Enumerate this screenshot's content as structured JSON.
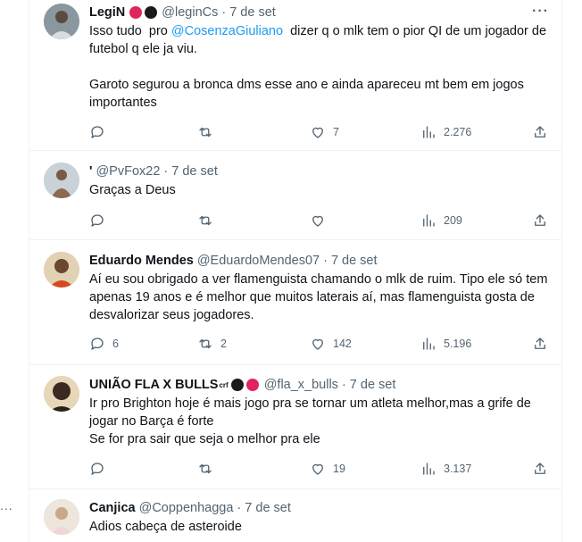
{
  "side": {
    "more_glyph": "..."
  },
  "tweets": [
    {
      "name": "LegiN",
      "handle": "@leginCs",
      "dot": "·",
      "date": "7 de set",
      "badges": [
        "#e0245e",
        "#1a1a1a"
      ],
      "text_before": "Isso tudo  pro ",
      "mention": "@CosenzaGiuliano",
      "text_after": "  dizer q o mlk tem o pior QI de um jogador de futebol q ele ja viu.",
      "text_p2": "Garoto segurou a bronca dms esse ano e ainda apareceu mt bem em jogos importantes",
      "replies": "",
      "retweets": "",
      "likes": "7",
      "views": "2.276",
      "avatar_icon": "person-avatar"
    },
    {
      "name": "'",
      "handle": "@PvFox22",
      "dot": "·",
      "date": "7 de set",
      "text": "Graças a Deus",
      "replies": "",
      "retweets": "",
      "likes": "",
      "views": "209",
      "avatar_icon": "person-avatar"
    },
    {
      "name": "Eduardo Mendes",
      "handle": "@EduardoMendes07",
      "dot": "·",
      "date": "7 de set",
      "text": "Aí eu sou obrigado a ver flamenguista chamando o mlk de ruim. Tipo ele só tem apenas 19 anos e é melhor que muitos laterais  aí, mas flamenguista gosta de desvalorizar seus jogadores.",
      "replies": "6",
      "retweets": "2",
      "likes": "142",
      "views": "5.196",
      "avatar_icon": "person-avatar"
    },
    {
      "name": "UNIÃO FLA X BULLS",
      "name_sup": "crf",
      "handle": "@fla_x_bulls",
      "dot": "·",
      "date": "7 de set",
      "badges": [
        "#1a1a1a",
        "#e0245e"
      ],
      "text_line1": "Ir pro Brighton hoje é mais jogo pra se tornar um atleta melhor,mas a grife de jogar no Barça é forte",
      "text_line2": "Se for pra sair que seja o melhor pra ele",
      "replies": "",
      "retweets": "",
      "likes": "19",
      "views": "3.137",
      "avatar_icon": "person-avatar"
    },
    {
      "name": "Canjica",
      "handle": "@Coppenhagga",
      "dot": "·",
      "date": "7 de set",
      "text": "Adios cabeça de asteroide",
      "avatar_icon": "person-avatar"
    }
  ],
  "colors": {
    "accent": "#1d9bf0",
    "muted": "#536471",
    "border": "#eff3f4"
  }
}
